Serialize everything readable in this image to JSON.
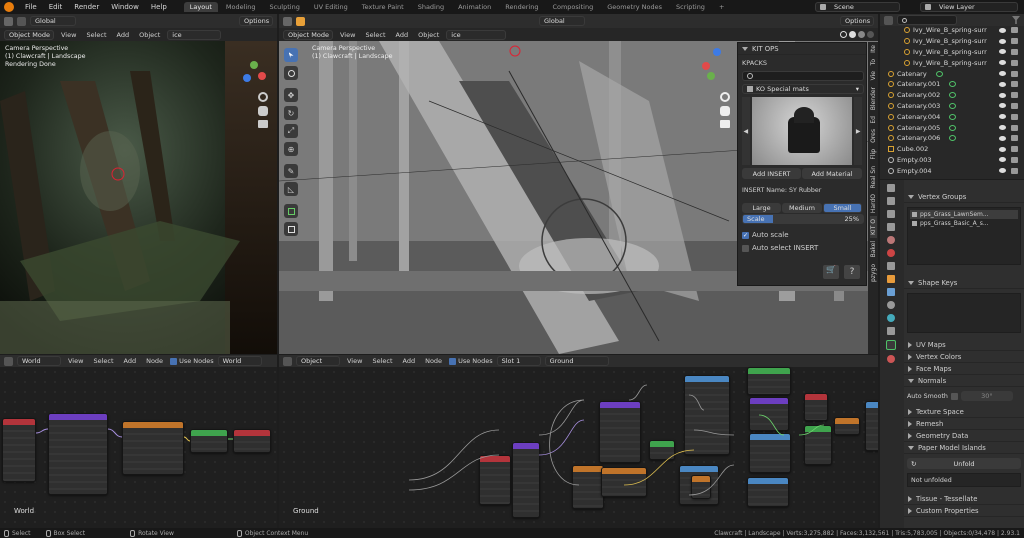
{
  "topbar": {
    "menus": [
      "File",
      "Edit",
      "Render",
      "Window",
      "Help"
    ],
    "workspaces": [
      "Layout",
      "Modeling",
      "Sculpting",
      "UV Editing",
      "Texture Paint",
      "Shading",
      "Animation",
      "Rendering",
      "Compositing",
      "Geometry Nodes",
      "Scripting"
    ],
    "active_workspace": "Layout",
    "add_tab": "+",
    "scene": "Scene",
    "view_layer": "View Layer"
  },
  "viewport_left": {
    "header": {
      "transform": "Global",
      "options": "Options",
      "mode": "Object Mode",
      "view": "View",
      "select": "Select",
      "add": "Add",
      "object": "Object",
      "search": "ice"
    },
    "overlay_lines": [
      "Camera Perspective",
      "(1) Clawcraft | Landscape",
      "Rendering Done"
    ]
  },
  "viewport_main": {
    "header": {
      "transform": "Global",
      "options": "Options",
      "mode": "Object Mode",
      "view": "View",
      "select": "Select",
      "add": "Add",
      "object": "Object",
      "search": "ice"
    },
    "overlay_lines": [
      "Camera Perspective",
      "(1) Clawcraft | Landscape"
    ]
  },
  "kitops": {
    "title": "KIT OPS",
    "kpacks": "KPACKS",
    "search_placeholder": "",
    "pack": "KO Special mats",
    "add_insert": "Add INSERT",
    "add_material": "Add Material",
    "insert_name": "INSERT Name: SY Rubber",
    "sizes": [
      "Large",
      "Medium",
      "Small"
    ],
    "active_size": "Small",
    "scale_label": "Scale",
    "scale_value": "25%",
    "auto_scale": "Auto scale",
    "auto_scale_checked": true,
    "auto_select": "Auto select INSERT",
    "auto_select_checked": false
  },
  "npanel_tabs": [
    "Ite",
    "To",
    "Vie",
    "Blender",
    "Ed",
    "Ores",
    "Flip",
    "Real Sn",
    "HardO",
    "KIT O",
    "Bakel",
    "pzygo"
  ],
  "outliner": {
    "items": [
      {
        "name": "Ivy_Wire_B_spring-surr",
        "type": "curve",
        "indent": 2
      },
      {
        "name": "Ivy_Wire_B_spring-surr",
        "type": "curve",
        "indent": 2
      },
      {
        "name": "Ivy_Wire_B_spring-surr",
        "type": "curve",
        "indent": 2
      },
      {
        "name": "Ivy_Wire_B_spring-surr",
        "type": "curve",
        "indent": 2
      },
      {
        "name": "Catenary",
        "type": "curve",
        "indent": 0
      },
      {
        "name": "Catenary.001",
        "type": "curve",
        "indent": 0
      },
      {
        "name": "Catenary.002",
        "type": "curve",
        "indent": 0
      },
      {
        "name": "Catenary.003",
        "type": "curve",
        "indent": 0
      },
      {
        "name": "Catenary.004",
        "type": "curve",
        "indent": 0
      },
      {
        "name": "Catenary.005",
        "type": "curve",
        "indent": 0
      },
      {
        "name": "Catenary.006",
        "type": "curve",
        "indent": 0
      },
      {
        "name": "Cube.002",
        "type": "mesh",
        "indent": 0
      },
      {
        "name": "Empty.003",
        "type": "empty",
        "indent": 0
      },
      {
        "name": "Empty.004",
        "type": "empty",
        "indent": 0
      }
    ]
  },
  "properties": {
    "vertex_groups_title": "Vertex Groups",
    "vertex_groups": [
      "pps_Grass_LawnSem...",
      "pps_Grass_Basic_A_s..."
    ],
    "shape_keys": "Shape Keys",
    "collapsed": [
      "UV Maps",
      "Vertex Colors",
      "Face Maps",
      "Normals"
    ],
    "auto_smooth": "Auto Smooth",
    "auto_smooth_angle": "30°",
    "collapsed2": [
      "Texture Space",
      "Remesh",
      "Geometry Data",
      "Paper Model Islands"
    ],
    "unfold_btn": "Unfold",
    "not_unfolded": "Not unfolded",
    "collapsed3": [
      "Tissue - Tessellate",
      "Custom Properties"
    ]
  },
  "node_world": {
    "type": "World",
    "view": "View",
    "select": "Select",
    "add": "Add",
    "node": "Node",
    "use_nodes": "Use Nodes",
    "name": "World",
    "corner_label": "World"
  },
  "node_object": {
    "type": "Object",
    "view": "View",
    "select": "Select",
    "add": "Add",
    "node": "Node",
    "use_nodes": "Use Nodes",
    "slot": "Slot 1",
    "material": "Ground",
    "corner_label": "Ground"
  },
  "statusbar": {
    "left": [
      "Select",
      "Box Select",
      "Rotate View",
      "Object Context Menu"
    ],
    "right": "Clawcraft | Landscape | Verts:3,275,882 | Faces:3,132,561 | Tris:5,783,005 | Objects:0/34,478 | 2.93.1"
  },
  "colors": {
    "accent": "#4772b3",
    "axis_x": "#e24a4a",
    "axis_y": "#6ab04c",
    "axis_z": "#3d7be6",
    "curve_icon": "#d9a232",
    "modifier_green": "#4fc268"
  }
}
